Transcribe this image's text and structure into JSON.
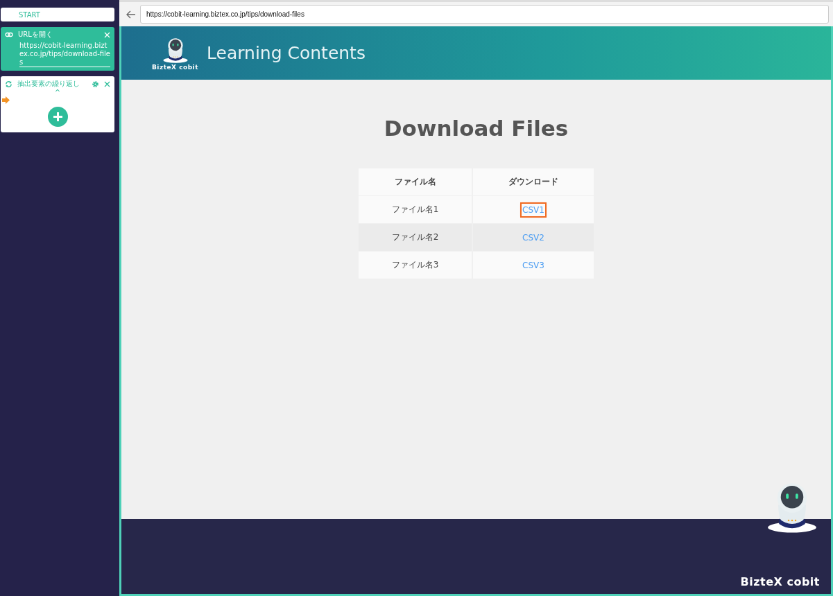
{
  "sidebar": {
    "start": "START",
    "steps": [
      {
        "kind": "open_url",
        "title": "URLを開く",
        "value": "https://cobit-learning.biztex.co.jp/tips/download-files"
      },
      {
        "kind": "loop",
        "title": "抽出要素の繰り返し",
        "caret": "^"
      }
    ]
  },
  "browser": {
    "url": "https://cobit-learning.biztex.co.jp/tips/download-files"
  },
  "site": {
    "brand": "BizteX cobit",
    "header_title": "Learning Contents",
    "heading": "Download Files",
    "footer_brand": "BizteX cobit"
  },
  "table": {
    "columns": [
      "ファイル名",
      "ダウンロード"
    ],
    "rows": [
      {
        "name": "ファイル名1",
        "link": "CSV1",
        "highlighted": true
      },
      {
        "name": "ファイル名2",
        "link": "CSV2",
        "highlighted": false
      },
      {
        "name": "ファイル名3",
        "link": "CSV3",
        "highlighted": false
      }
    ]
  }
}
